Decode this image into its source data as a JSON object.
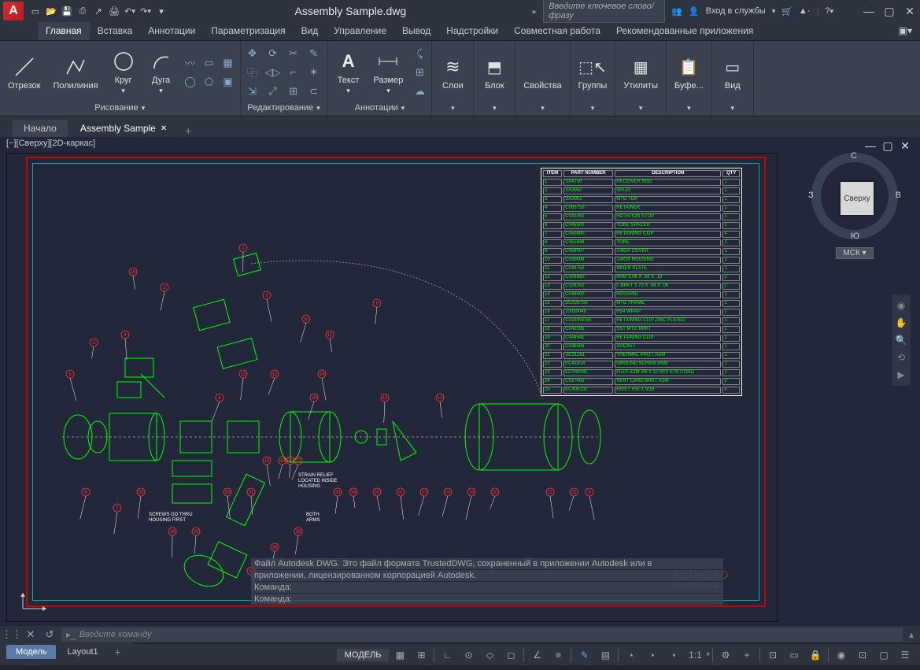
{
  "titlebar": {
    "app": "A",
    "filename": "Assembly Sample.dwg",
    "search_placeholder": "Введите ключевое слово/фразу",
    "signin": "Вход в службы",
    "qat": [
      "new",
      "open",
      "save",
      "saveall",
      "plot",
      "undo",
      "redo"
    ]
  },
  "ribbon_tabs": [
    "Главная",
    "Вставка",
    "Аннотации",
    "Параметризация",
    "Вид",
    "Управление",
    "Вывод",
    "Надстройки",
    "Совместная работа",
    "Рекомендованные приложения"
  ],
  "ribbon_active": 0,
  "panels": {
    "draw": {
      "title": "Рисование",
      "btns": [
        "Отрезок",
        "Полилиния",
        "Круг",
        "Дуга"
      ]
    },
    "modify": {
      "title": "Редактирование"
    },
    "annot": {
      "title": "Аннотации",
      "btns": [
        "Текст",
        "Размер"
      ]
    },
    "layers": {
      "title": "Слои"
    },
    "block": {
      "title": "Блок"
    },
    "props": {
      "title": "Свойства"
    },
    "groups": {
      "title": "Группы"
    },
    "utils": {
      "title": "Утилиты"
    },
    "clip": {
      "title": "Буфе..."
    },
    "view": {
      "title": "Вид"
    }
  },
  "filetabs": {
    "start": "Начало",
    "active": "Assembly Sample"
  },
  "viewport": {
    "label": "[−][Сверху][2D-каркас]"
  },
  "viewcube": {
    "top": "Сверху",
    "n": "С",
    "s": "Ю",
    "e": "В",
    "w": "З",
    "wcs": "МСК"
  },
  "bom": {
    "headers": [
      "ITEM",
      "PART NUMBER",
      "DESCRIPTION",
      "QTY"
    ],
    "rows": [
      [
        "1",
        "SA4750",
        "RECEIVER HSG",
        "1"
      ],
      [
        "2",
        "SA3950",
        "SPLAY",
        "1"
      ],
      [
        "3",
        "SA3951",
        "MTG TOP",
        "1"
      ],
      [
        "4",
        "C065750",
        "RETAINER",
        "1"
      ],
      [
        "5",
        "C042350",
        "ROTATION STOP",
        "1"
      ],
      [
        "6",
        "C045500",
        "YOKE SPACER",
        "1"
      ],
      [
        "7",
        "C050800",
        "RETAINING CLIP",
        "4"
      ],
      [
        "8",
        "C051848",
        "YOKE",
        "1"
      ],
      [
        "9",
        "C069007",
        "J-BOX COVER",
        "1"
      ],
      [
        "10",
        "C030699",
        "J-BOX HOUSING",
        "1"
      ],
      [
        "11",
        "C044750",
        "INNER PLATE",
        "1"
      ],
      [
        "12",
        "C029850",
        "ARM 9.96 X .88 X .19",
        "2"
      ],
      [
        "13",
        "C029250",
        "L-BRKT 1.70 X .94 X .06",
        "2"
      ],
      [
        "14",
        "C044400",
        "HOUSING",
        "1"
      ],
      [
        "15",
        "SC029750",
        "MTG FRAME",
        "1"
      ],
      [
        "16",
        "10030048",
        "H54 WRAP",
        "1"
      ],
      [
        "17",
        "C0228SEVE",
        "RETAINING CLIP ZINC PLATED",
        "1"
      ],
      [
        "18",
        "C042095",
        "SST MTG BRKT",
        "1"
      ],
      [
        "19",
        "C044541",
        "RETAINING CLIP",
        "2"
      ],
      [
        "20",
        "C036506",
        "SOCKET",
        "1"
      ],
      [
        "21",
        "SC31261",
        "THERMAL PROT. ASM",
        "1"
      ],
      [
        "22",
        "EC41914",
        "GROUND SCREW ASM",
        "1"
      ],
      [
        "23",
        "EC044041",
        "FLEX ASM 3/8 X 10 W/3 STR COND",
        "1"
      ],
      [
        "24",
        "C017450",
        "VERT CARD BRKT ASM",
        "2"
      ],
      [
        "25",
        "EC408131",
        "RIVET #30 X 9/16",
        "4"
      ]
    ]
  },
  "notes": {
    "strain": "STRAIN RELIEF\nLOCATED INSIDE\nHOUSING",
    "screws": "SCREWS GO THRU\nHOUSING FIRST",
    "arms": "BOTH\nARMS"
  },
  "cmdhist": {
    "l1": "Файл Autodesk DWG. Это файл формата TrustedDWG, сохраненный в приложении Autodesk или в",
    "l2": "приложении, лицензированном корпорацией Autodesk.",
    "l3": "Команда:",
    "l4": "Команда:"
  },
  "watermark": {
    "line1": "AutoCAD",
    "line2": "Sample Drawing"
  },
  "cmdline": {
    "placeholder": "Введите команду"
  },
  "layouts": {
    "model": "Модель",
    "l1": "Layout1"
  },
  "status": {
    "model": "МОДЕЛЬ",
    "scale": "1:1"
  }
}
